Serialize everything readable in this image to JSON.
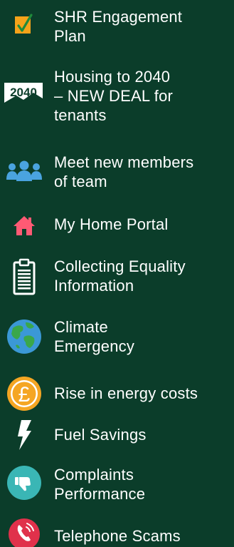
{
  "colors": {
    "background": "#0b3d2a",
    "text": "#ffffff",
    "checkbox_orange": "#f5a31a",
    "check_green": "#1f8a3b",
    "team_blue": "#4aa3df",
    "home_pink": "#ff5a74",
    "earth_blue": "#3b98d6",
    "earth_green": "#3aa74a",
    "pound_orange": "#f5a623",
    "complaints_teal": "#3ab6b5",
    "phone_red": "#e0314b"
  },
  "menu": {
    "items": [
      {
        "label_lines": [
          "SHR Engagement",
          "Plan"
        ],
        "icon": "checkbox-icon"
      },
      {
        "label_lines": [
          "Housing to 2040",
          "– NEW DEAL for",
          "tenants"
        ],
        "icon": "housing-2040-icon",
        "icon_text": "2040"
      },
      {
        "label_lines": [
          "Meet new members",
          "of team"
        ],
        "icon": "team-icon"
      },
      {
        "label_lines": [
          "My Home Portal"
        ],
        "icon": "home-icon"
      },
      {
        "label_lines": [
          "Collecting Equality",
          "Information"
        ],
        "icon": "clipboard-icon"
      },
      {
        "label_lines": [
          "Climate",
          "Emergency"
        ],
        "icon": "earth-icon"
      },
      {
        "label_lines": [
          "Rise in energy costs"
        ],
        "icon": "pound-icon",
        "icon_text": "£"
      },
      {
        "label_lines": [
          "Fuel Savings"
        ],
        "icon": "lightning-icon"
      },
      {
        "label_lines": [
          "Complaints",
          "Performance"
        ],
        "icon": "thumbs-down-icon"
      },
      {
        "label_lines": [
          "Telephone Scams"
        ],
        "icon": "phone-icon"
      }
    ]
  }
}
